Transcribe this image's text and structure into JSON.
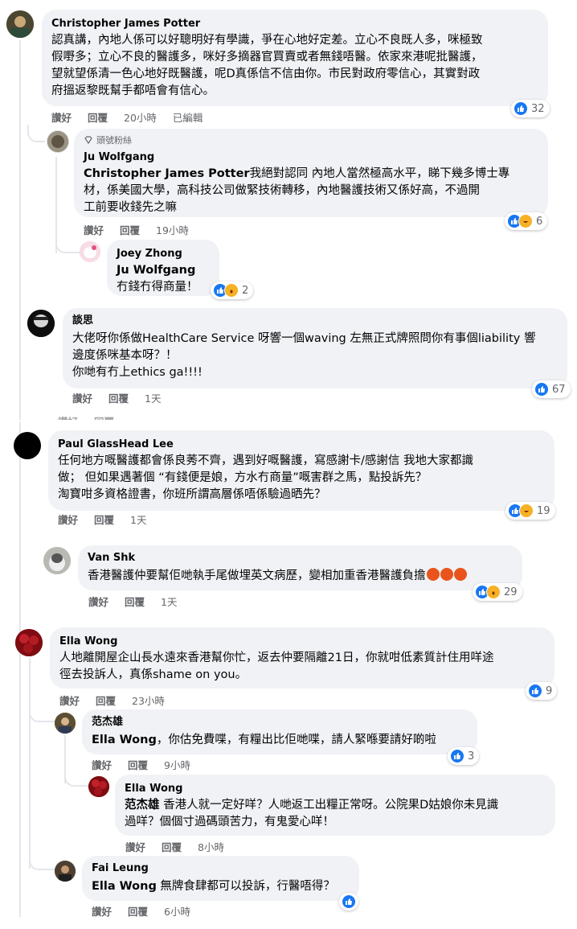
{
  "comments": [
    {
      "name": "Christopher James Potter",
      "lines": [
        "認真講，內地人係可以好聰明好有學識，爭在心地好定差。立心不良既人多，咪極致",
        "假嘢多；立心不良的醫護多，咪好多摘器官買賣或者無錢唔醫。依家來港呢批醫護，",
        "望就望係清一色心地好既醫護，呢D真係信不信由你。市民對政府零信心，其實對政",
        "府搵返黎既幫手都唔會有信心。"
      ],
      "actions": {
        "like": "讚好",
        "reply": "回覆",
        "time": "20小時",
        "edited": "已編輯"
      },
      "reaction_count": "32"
    },
    {
      "badge": "頭號粉絲",
      "name": "Ju Wolfgang",
      "tag": "Christopher James Potter",
      "lines": [
        "我絕對認同 內地人當然極高水平，睇下幾多博士專",
        "材，係美國大學，高科技公司做緊技術轉移，內地醫護技術又係好高，不過開",
        "工前要收錢先之嘛"
      ],
      "actions": {
        "like": "讚好",
        "reply": "回覆",
        "time": "19小時"
      },
      "reaction_count": "6"
    },
    {
      "name": "Joey Zhong",
      "tag": "Ju Wolfgang",
      "lines": [
        "冇錢冇得商量！"
      ],
      "reaction_count": "2"
    },
    {
      "name": "談思",
      "lines": [
        "大佬呀你係做HealthCare Service 呀響一個waving 左無正式牌照問你有事個liability 響",
        "邊度係咪基本呀？！",
        "你哋有冇上ethics ga!!!!"
      ],
      "actions": {
        "like": "讚好",
        "reply": "回覆",
        "time": "1天"
      },
      "reaction_count": "67"
    },
    {
      "name": "Paul GlassHead Lee",
      "lines": [
        "任何地方嘅醫護都會係良莠不齊，遇到好嘅醫護，寫感謝卡/感謝信 我地大家都識",
        "做； 但如果遇著個 “有錢便是娘，方水冇商量”嘅害群之馬，點投訴先？",
        "淘寶咁多資格證書，你班所謂高層係唔係驗過晒先？"
      ],
      "actions": {
        "like": "讚好",
        "reply": "回覆",
        "time": "1天"
      },
      "reaction_count": "19"
    },
    {
      "name": "Van Shk",
      "lines": [
        "香港醫護仲要幫佢哋執手尾做埋英文病歷，變相加重香港醫護負擔"
      ],
      "actions": {
        "like": "讚好",
        "reply": "回覆",
        "time": "1天"
      },
      "reaction_count": "29"
    },
    {
      "name": "Ella Wong",
      "lines": [
        "人地離開屋企山長水遠來香港幫你忙，返去仲要隔離21日，你就咁低素質計住用咩途",
        "徑去投訴人，真係shame on you。"
      ],
      "actions": {
        "like": "讚好",
        "reply": "回覆",
        "time": "23小時"
      },
      "reaction_count": "9"
    },
    {
      "name": "范杰雄",
      "tag": "Ella Wong",
      "lines": [
        "，你估免費喋，有糧出比佢哋喋，請人緊喺要請好啲啦"
      ],
      "actions": {
        "like": "讚好",
        "reply": "回覆",
        "time": "9小時"
      },
      "reaction_count": "3"
    },
    {
      "name": "Ella Wong",
      "tag": "范杰雄",
      "lines": [
        " 香港人就一定好咩？人哋返工出糧正常呀。公院果D姑娘你未見識",
        "過咩？個個寸過碼頭苦力，有鬼愛心咩！"
      ],
      "actions": {
        "like": "讚好",
        "reply": "回覆",
        "time": "8小時"
      }
    },
    {
      "name": "Fai Leung",
      "tag": "Ella Wong",
      "lines": [
        " 無牌食肆都可以投訴，行醫唔得？"
      ],
      "actions": {
        "like": "讚好",
        "reply": "回覆",
        "time": "6小時"
      }
    }
  ],
  "hidden_row": {
    "like": "讚好",
    "reply": "回覆"
  },
  "colors": {
    "bubble": "#f0f2f5",
    "like": "#1877f2",
    "meta": "#65676b"
  }
}
